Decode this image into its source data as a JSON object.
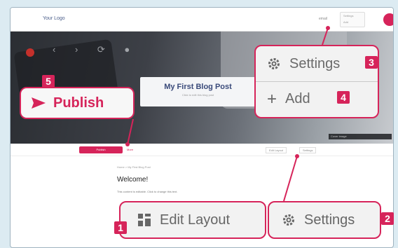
{
  "header": {
    "logo": "Your Logo",
    "email": "email",
    "mini_menu": [
      "Settings",
      "Add"
    ]
  },
  "hero": {
    "title": "My First Blog Post",
    "subtitle": "Click to edit this blog post",
    "caption": "Cover image"
  },
  "admin_bar": {
    "publish_label": "Publish",
    "more_label": "More",
    "edit_layout_label": "Edit Layout",
    "settings_label": "Settings"
  },
  "content": {
    "breadcrumb": "Home > My First Blog Post",
    "heading": "Welcome!",
    "paragraph": "This content is editable. Click to change this text."
  },
  "callouts": {
    "publish": {
      "number": "5",
      "label": "Publish"
    },
    "settings_menu": {
      "number": "3",
      "label": "Settings"
    },
    "add": {
      "number": "4",
      "label": "Add"
    },
    "edit_layout": {
      "number": "1",
      "label": "Edit Layout"
    },
    "settings": {
      "number": "2",
      "label": "Settings"
    }
  },
  "colors": {
    "accent": "#d6245a",
    "callout_bg": "#f2f2f2",
    "page_bg": "#dcebf2"
  }
}
